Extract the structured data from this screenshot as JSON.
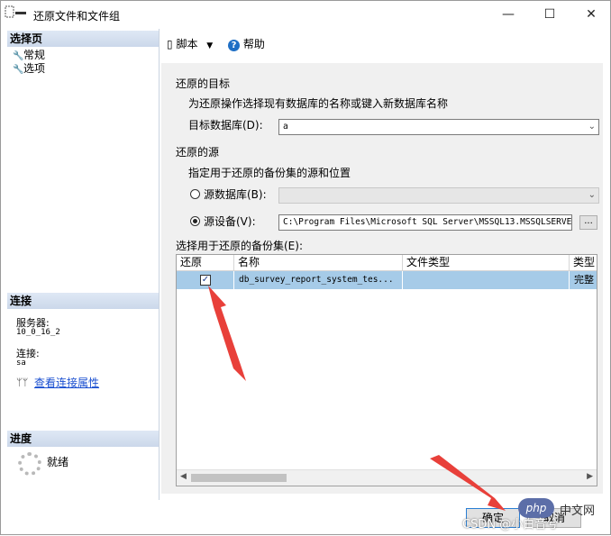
{
  "window": {
    "title": "还原文件和文件组",
    "controls": {
      "minimize": "—",
      "maximize": "☐",
      "close": "✕"
    }
  },
  "sidebar": {
    "select_page_header": "选择页",
    "pages": [
      {
        "label": "常规",
        "icon": "wrench-icon"
      },
      {
        "label": "选项",
        "icon": "wrench-icon"
      }
    ],
    "connection_header": "连接",
    "server_label": "服务器:",
    "server_value": "10_0_16_2",
    "connection_label": "连接:",
    "connection_value": "sa",
    "view_connection_link": "查看连接属性",
    "progress_header": "进度",
    "progress_status": "就绪"
  },
  "toolbar": {
    "script_label": "脚本",
    "help_label": "帮助"
  },
  "form": {
    "restore_target_title": "还原的目标",
    "restore_target_desc": "为还原操作选择现有数据库的名称或键入新数据库名称",
    "target_db_label": "目标数据库(D):",
    "target_db_value": "a",
    "restore_source_title": "还原的源",
    "restore_source_desc": "指定用于还原的备份集的源和位置",
    "source_db_label": "源数据库(B):",
    "source_db_value": "",
    "source_device_label": "源设备(V):",
    "source_device_value": "C:\\Program Files\\Microsoft SQL Server\\MSSQL13.MSSQLSERVE",
    "browse_label": "...",
    "selected_source": "device",
    "backup_sets_label": "选择用于还原的备份集(E):"
  },
  "backup_table": {
    "columns": [
      "还原",
      "名称",
      "文件类型",
      "类型"
    ],
    "rows": [
      {
        "restore": true,
        "name": "db_survey_report_system_tes...",
        "file_type": "",
        "type": "完整"
      }
    ]
  },
  "buttons": {
    "ok": "确定",
    "cancel": "取消"
  },
  "watermark": {
    "badge": "php",
    "text1": "中文网",
    "text2": "CSDN @小白音兮"
  },
  "colors": {
    "header_gradient": "#cbd8ea",
    "selected_row": "#a6cbe8",
    "link": "#1a4fd0",
    "annotation_arrow": "#e8403a"
  }
}
